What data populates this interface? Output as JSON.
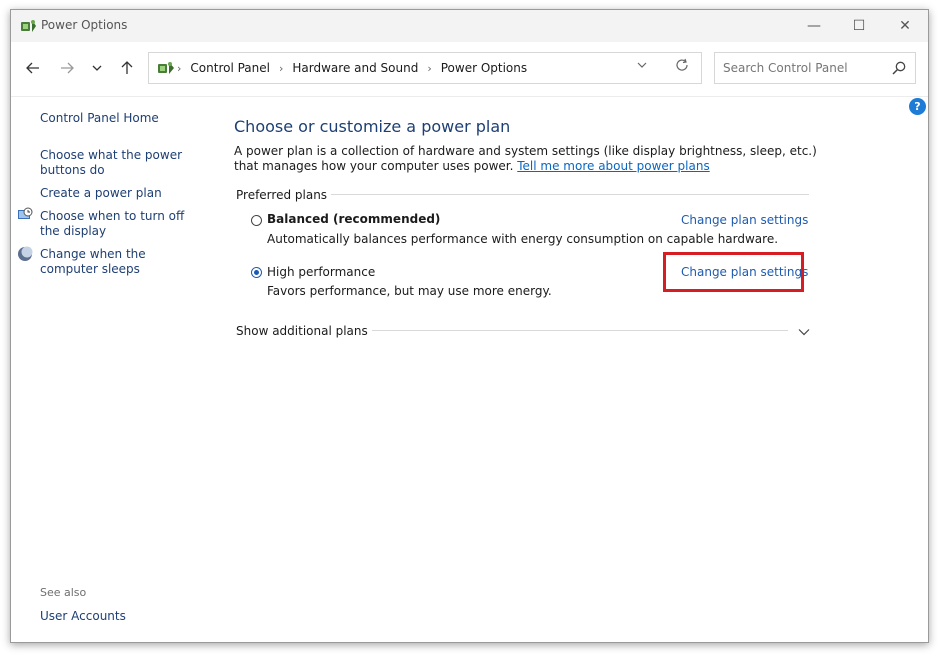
{
  "window": {
    "title": "Power Options",
    "controls": {
      "minimize": "—",
      "maximize": "☐",
      "close": "✕"
    }
  },
  "nav": {
    "breadcrumbs": [
      "Control Panel",
      "Hardware and Sound",
      "Power Options"
    ],
    "separator": "›",
    "search_placeholder": "Search Control Panel"
  },
  "help": {
    "label": "?"
  },
  "sidebar": {
    "items": [
      {
        "label": "Control Panel Home",
        "icon": ""
      },
      {
        "label": "Choose what the power buttons do",
        "icon": ""
      },
      {
        "label": "Create a power plan",
        "icon": ""
      },
      {
        "label": "Choose when to turn off the display",
        "icon": "monitor-clock-icon"
      },
      {
        "label": "Change when the computer sleeps",
        "icon": "moon-icon"
      }
    ],
    "see_also_label": "See also",
    "see_also_items": [
      "User Accounts"
    ]
  },
  "main": {
    "title": "Choose or customize a power plan",
    "description": "A power plan is a collection of hardware and system settings (like display brightness, sleep, etc.) that manages how your computer uses power.",
    "learn_more_link": "Tell me more about power plans",
    "preferred_plans_label": "Preferred plans",
    "plans": [
      {
        "name": "Balanced (recommended)",
        "description": "Automatically balances performance with energy consumption on capable hardware.",
        "selected": false,
        "link": "Change plan settings"
      },
      {
        "name": "High performance",
        "description": "Favors performance, but may use more energy.",
        "selected": true,
        "link": "Change plan settings"
      }
    ],
    "additional_plans_label": "Show additional plans"
  },
  "colors": {
    "link": "#1e3f73",
    "accent": "#1e5bb0",
    "highlight": "#d71d24"
  }
}
